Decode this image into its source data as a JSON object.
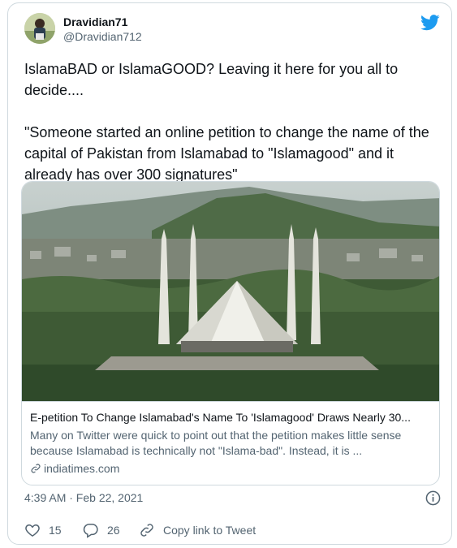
{
  "tweet": {
    "display_name": "Dravidian71",
    "handle": "@Dravidian712",
    "text": "IslamaBAD or IslamaGOOD? Leaving it here for you all to decide....\n\n\"Someone started an online petition to change the name of the capital of Pakistan from Islamabad to \"Islamagood\" and it already has over 300 signatures\"",
    "timestamp": "4:39 AM · Feb 22, 2021"
  },
  "link_card": {
    "title": "E-petition To Change Islamabad's Name To 'Islamagood' Draws Nearly 30...",
    "description": "Many on Twitter were quick to point out that the petition makes little sense because Islamabad is technically not \"Islama-bad\". Instead, it is ...",
    "domain": "indiatimes.com"
  },
  "actions": {
    "like_count": "15",
    "reply_count": "26",
    "copy_label": "Copy link to Tweet"
  },
  "icons": {
    "twitter_logo": "twitter-bird-icon",
    "like": "heart-icon",
    "reply": "speech-bubble-icon",
    "copy": "link-icon",
    "info": "info-icon"
  },
  "colors": {
    "brand": "#1d9bf0",
    "text_primary": "#0f1419",
    "text_secondary": "#536471",
    "border": "#cfd9de"
  }
}
